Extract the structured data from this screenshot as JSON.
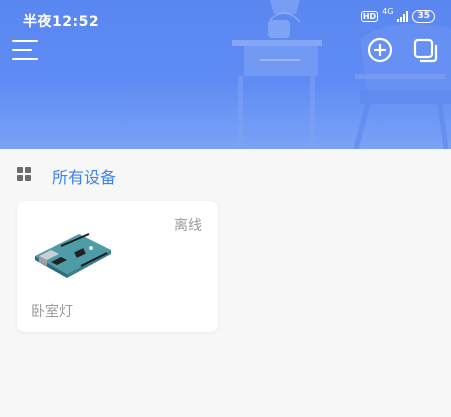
{
  "status_bar": {
    "time": "半夜12:52",
    "hd_badge": "HD",
    "network": "4G",
    "battery": "35"
  },
  "header": {
    "menu_icon": "hamburger-menu-icon",
    "add_icon": "plus-circle-icon",
    "copy_icon": "copy-squares-icon"
  },
  "section": {
    "title": "所有设备",
    "icon": "grid-icon"
  },
  "devices": [
    {
      "name": "卧室灯",
      "status": "离线",
      "image": "arduino-board"
    }
  ],
  "colors": {
    "header_gradient_top": "#5a86f0",
    "header_gradient_bottom": "#7aa3f6",
    "accent": "#3a84e6",
    "muted_text": "#9a9a9a",
    "page_bg": "#f7f7f8"
  }
}
